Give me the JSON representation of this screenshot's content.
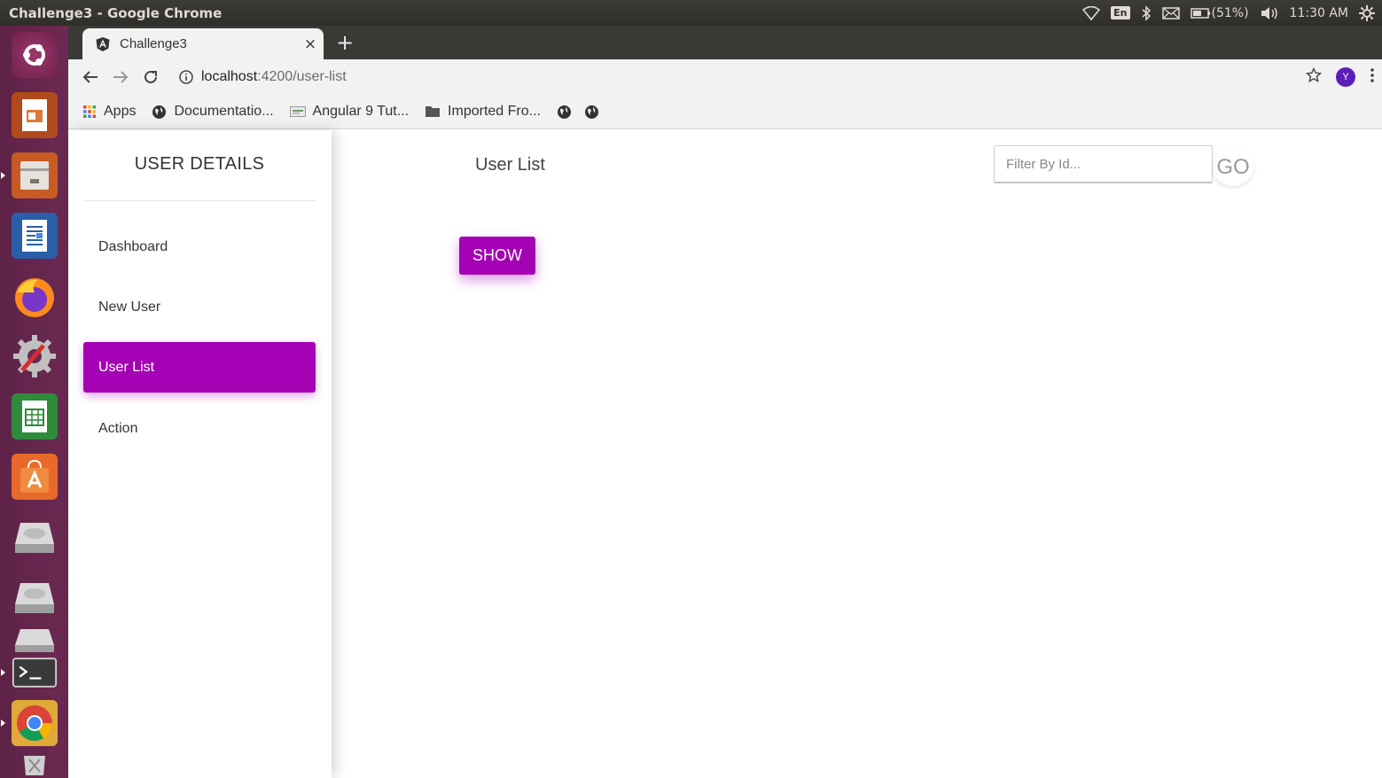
{
  "window": {
    "title": "Challenge3 - Google Chrome"
  },
  "panel": {
    "lang": "En",
    "battery": "(51%)",
    "time": "11:30 AM"
  },
  "colors": {
    "accent": "#a400b4",
    "launcher": "#5e2247",
    "panel": "#3c3b37"
  },
  "launcher": {
    "items": [
      {
        "icon": "ubuntu-dash-icon"
      },
      {
        "icon": "impress-icon"
      },
      {
        "icon": "files-icon"
      },
      {
        "icon": "writer-icon"
      },
      {
        "icon": "firefox-icon"
      },
      {
        "icon": "system-settings-icon"
      },
      {
        "icon": "calc-icon"
      },
      {
        "icon": "software-center-icon"
      },
      {
        "icon": "disk-icon"
      },
      {
        "icon": "disk-icon"
      },
      {
        "icon": "disk-icon"
      },
      {
        "icon": "terminal-icon"
      },
      {
        "icon": "chrome-icon"
      },
      {
        "icon": "trash-icon"
      }
    ]
  },
  "browser": {
    "tab": {
      "title": "Challenge3",
      "close": "×"
    },
    "new_tab": "+",
    "url": {
      "host": "localhost",
      "path": ":4200/user-list"
    },
    "profile_initial": "Y",
    "bookmarks": [
      {
        "label": "Apps",
        "icon": "apps-grid-icon"
      },
      {
        "label": "Documentatio...",
        "icon": "globe-icon"
      },
      {
        "label": "Angular 9 Tut...",
        "icon": "page-icon"
      },
      {
        "label": "Imported Fro...",
        "icon": "folder-icon"
      },
      {
        "label": "",
        "icon": "globe-icon"
      },
      {
        "label": "",
        "icon": "globe-icon"
      }
    ]
  },
  "sidebar": {
    "title": "USER DETAILS",
    "items": [
      {
        "label": "Dashboard",
        "active": false
      },
      {
        "label": "New User",
        "active": false
      },
      {
        "label": "User List",
        "active": true
      },
      {
        "label": "Action",
        "active": false
      }
    ]
  },
  "main": {
    "title": "User List",
    "filter_placeholder": "Filter By Id...",
    "go_label": "GO",
    "show_label": "SHOW"
  }
}
